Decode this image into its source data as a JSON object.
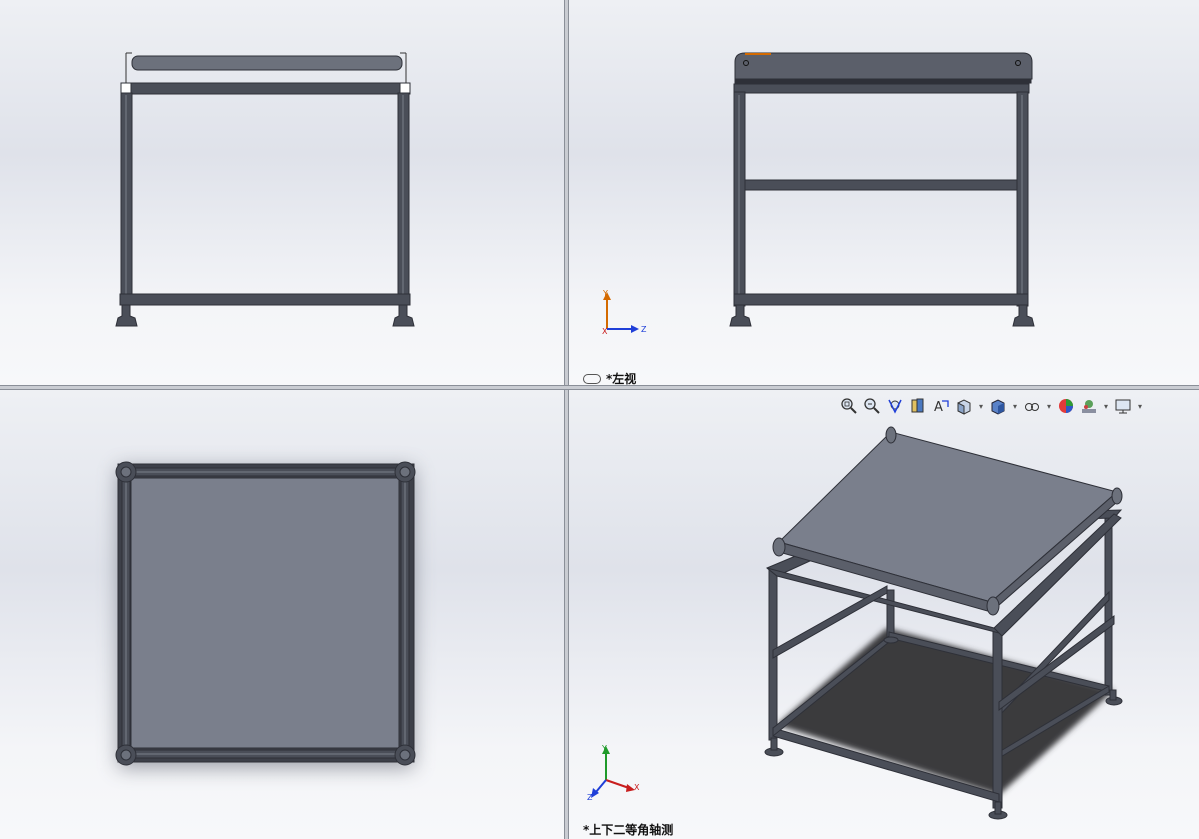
{
  "viewports": {
    "top_left": {
      "label": ""
    },
    "top_right": {
      "label": "*左视",
      "triad_axes": [
        "Y",
        "Z",
        "X"
      ]
    },
    "bottom_left": {
      "label": ""
    },
    "bottom_right": {
      "label": "*上下二等角轴测",
      "triad_axes": [
        "Y",
        "X",
        "Z"
      ]
    }
  },
  "heads_up_toolbar": {
    "tools": [
      {
        "name": "zoom-to-fit-icon",
        "dropdown": false
      },
      {
        "name": "zoom-to-area-icon",
        "dropdown": false
      },
      {
        "name": "previous-view-icon",
        "dropdown": false
      },
      {
        "name": "section-view-icon",
        "dropdown": false
      },
      {
        "name": "dynamic-annotation-icon",
        "dropdown": false
      },
      {
        "name": "view-orientation-icon",
        "dropdown": true
      },
      {
        "name": "display-style-icon",
        "dropdown": true
      },
      {
        "name": "hide-show-items-icon",
        "dropdown": true
      },
      {
        "name": "edit-appearance-icon",
        "dropdown": false
      },
      {
        "name": "apply-scene-icon",
        "dropdown": true
      },
      {
        "name": "view-settings-icon",
        "dropdown": true
      }
    ]
  },
  "colors": {
    "frame": "#3d4049",
    "frame_light": "#6c717c",
    "panel": "#7a7f8c",
    "shadow": "#3c3c3e",
    "axis_y": "#d46a00",
    "axis_z": "#1f3fd8",
    "axis_x": "#c81e1e",
    "axis_green": "#1f9a2a"
  }
}
